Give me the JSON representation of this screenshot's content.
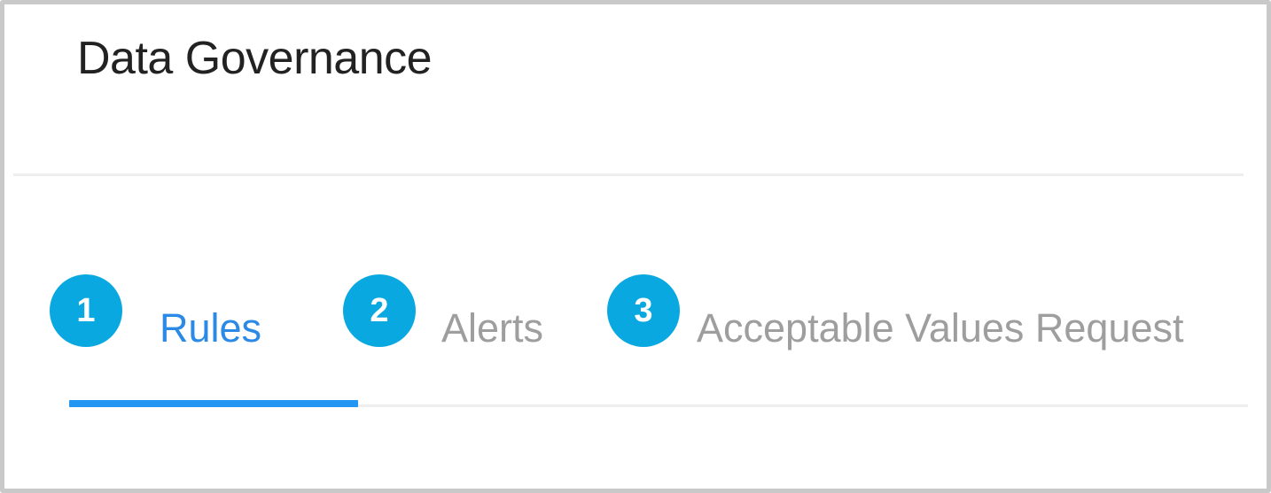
{
  "page": {
    "title": "Data Governance"
  },
  "tabs": [
    {
      "label": "Rules",
      "active": true
    },
    {
      "label": "Alerts",
      "active": false
    },
    {
      "label": "Acceptable Values Request",
      "active": false
    }
  ],
  "badges": [
    "1",
    "2",
    "3"
  ],
  "colors": {
    "active_tab": "#2b8ae6",
    "inactive_tab": "#9e9e9e",
    "indicator": "#2196f3",
    "badge": "#0aa8e0"
  }
}
